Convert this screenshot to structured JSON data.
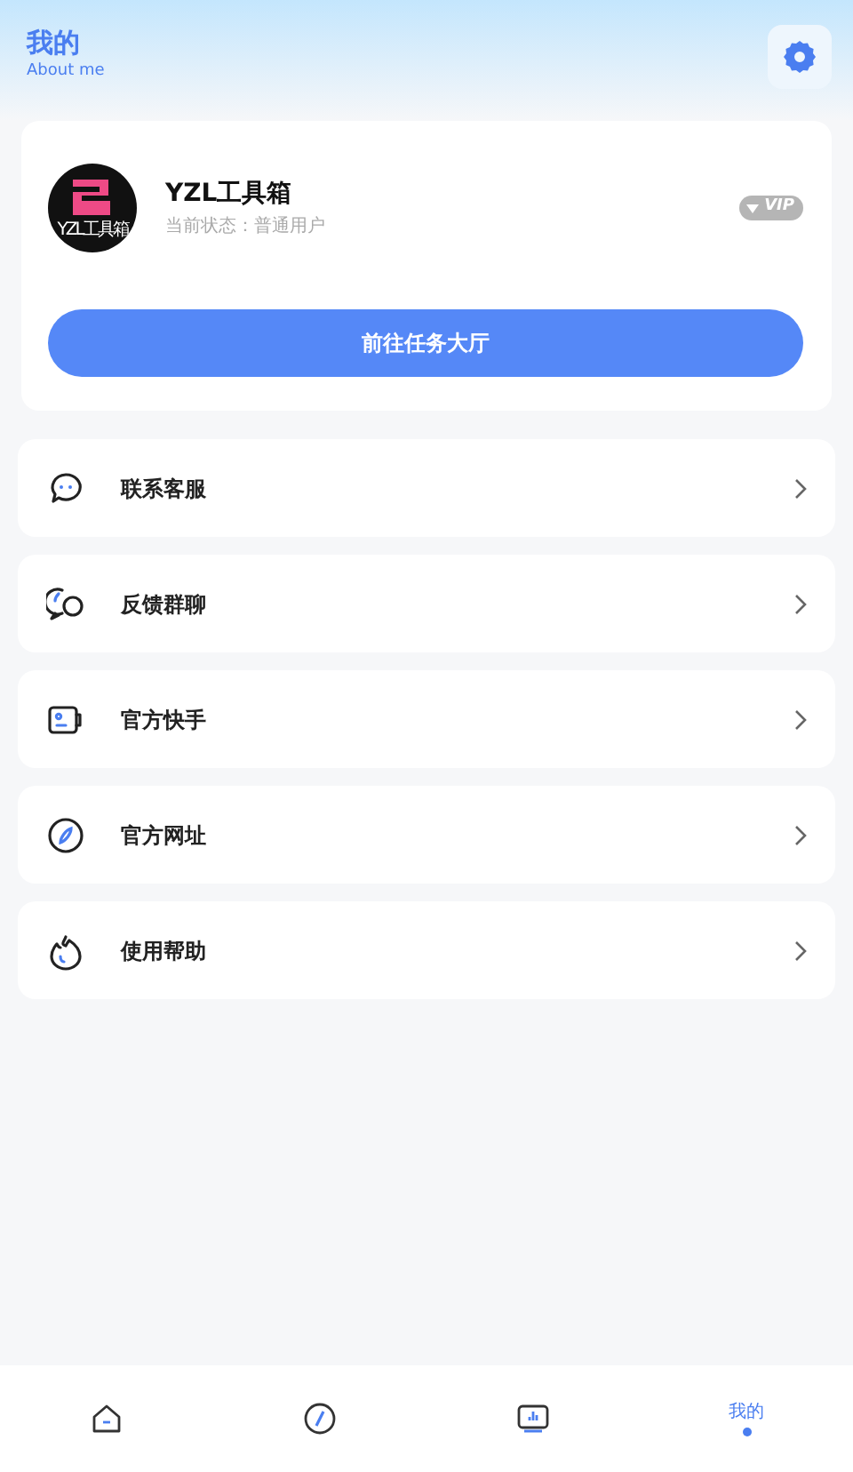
{
  "header": {
    "title": "我的",
    "subtitle": "About me"
  },
  "profile": {
    "avatar_caption": "YZL工具箱",
    "name": "YZL工具箱",
    "status": "当前状态：普通用户",
    "badge": "VIP",
    "button": "前往任务大厅"
  },
  "menu": [
    {
      "kind": "chat",
      "label": "联系客服"
    },
    {
      "kind": "group",
      "label": "反馈群聊"
    },
    {
      "kind": "card",
      "label": "官方快手"
    },
    {
      "kind": "compass",
      "label": "官方网址"
    },
    {
      "kind": "flame",
      "label": "使用帮助"
    }
  ],
  "tabbar": [
    {
      "kind": "home",
      "selected": false
    },
    {
      "kind": "compass",
      "selected": false
    },
    {
      "kind": "monitor",
      "selected": false
    },
    {
      "kind": "me",
      "label": "我的",
      "selected": true
    }
  ]
}
